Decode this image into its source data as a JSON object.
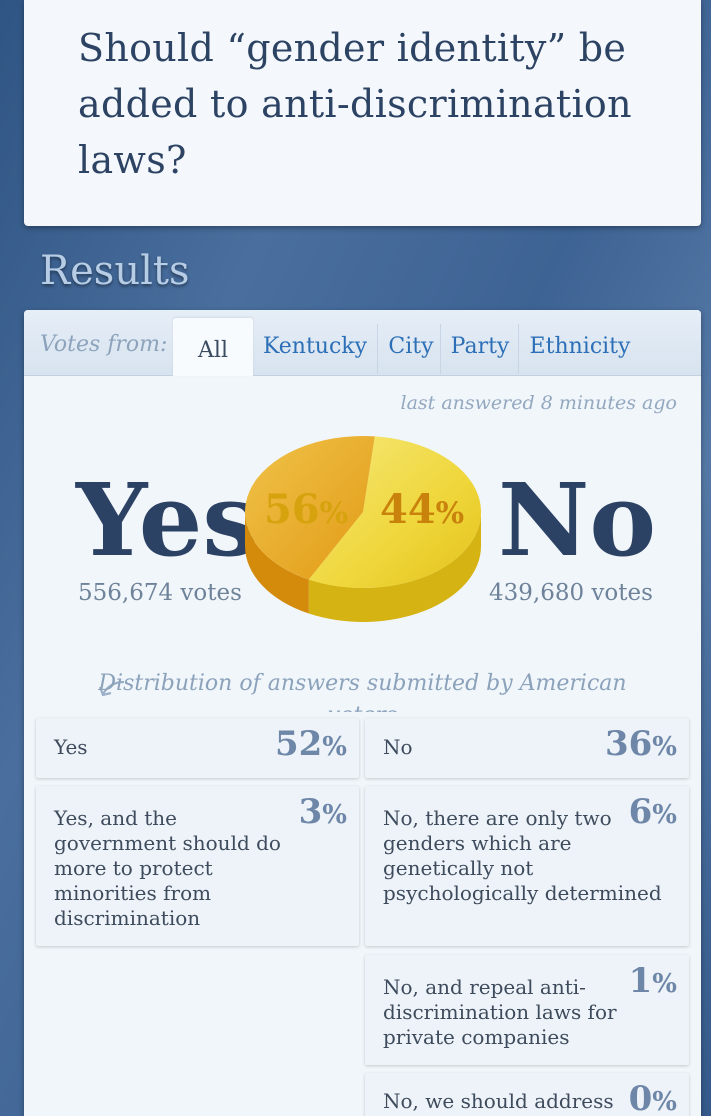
{
  "question": "Should “gender identity” be added to anti-discrimination laws?",
  "results_heading": "Results",
  "votes_from_label": "Votes from:",
  "tabs": [
    {
      "label": "All",
      "active": true
    },
    {
      "label": "Kentucky",
      "active": false
    },
    {
      "label": "City",
      "active": false
    },
    {
      "label": "Party",
      "active": false
    },
    {
      "label": "Ethnicity",
      "active": false
    }
  ],
  "last_answered": "last answered 8 minutes ago",
  "summary": {
    "yes_label": "Yes",
    "no_label": "No",
    "yes_votes": "556,674 votes",
    "no_votes": "439,680 votes",
    "yes_pct": "56",
    "no_pct": "44",
    "pct_symbol": "%"
  },
  "chart_data": {
    "type": "pie",
    "categories": [
      "Yes",
      "No"
    ],
    "values": [
      56,
      44
    ],
    "colors": [
      "#f0d63a",
      "#e9a81e"
    ]
  },
  "distribution_note": "Distribution of answers submitted by American voters",
  "answers": [
    {
      "label": "Yes",
      "pct": "52"
    },
    {
      "label": "No",
      "pct": "36"
    },
    {
      "label": "Yes, and the government should do more to protect minorities from discrimination",
      "pct": "3"
    },
    {
      "label": "No, there are only two genders which are genetically not psychologically determined",
      "pct": "6"
    },
    {
      "label": "No, and repeal anti-discrimination laws for private companies",
      "pct": "1"
    },
    {
      "label": "No, we should address",
      "pct": "0"
    }
  ],
  "colors": {
    "accent_blue": "#2c6fb6",
    "heading_navy": "#2c4264",
    "yes_yellow": "#f0d63a",
    "no_orange": "#e9a81e"
  }
}
